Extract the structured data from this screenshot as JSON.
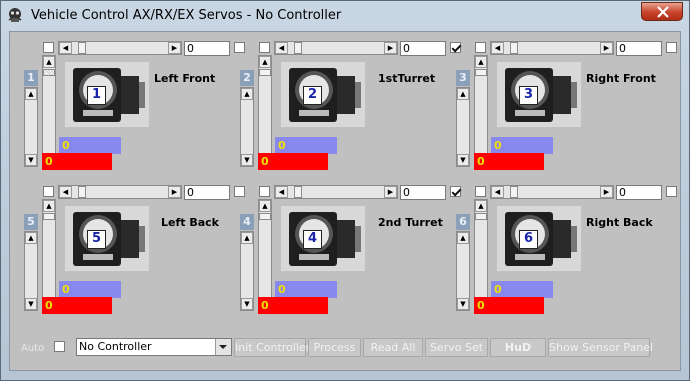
{
  "window": {
    "title": "Vehicle Control AX/RX/EX Servos - No Controller"
  },
  "panels": [
    {
      "id": "1",
      "label": "Left Front",
      "value": "0",
      "blue": "0",
      "red": "0",
      "checked": false
    },
    {
      "id": "2",
      "label": "1stTurret",
      "value": "0",
      "blue": "0",
      "red": "0",
      "checked": true
    },
    {
      "id": "3",
      "label": "Right Front",
      "value": "0",
      "blue": "0",
      "red": "0",
      "checked": false
    },
    {
      "id": "5",
      "label": "Left Back",
      "value": "0",
      "blue": "0",
      "red": "0",
      "checked": false
    },
    {
      "id": "4",
      "label": "2nd Turret",
      "value": "0",
      "blue": "0",
      "red": "0",
      "checked": true
    },
    {
      "id": "6",
      "label": "Right Back",
      "value": "0",
      "blue": "0",
      "red": "0",
      "checked": false
    }
  ],
  "bottom": {
    "auto_label": "Auto",
    "controller_select": "No Controller",
    "buttons": [
      "Init Controller",
      "Process",
      "Read All",
      "Servo Set",
      "HuD",
      "Show Sensor Panel"
    ]
  },
  "colors": {
    "blue_bar": "#8888ee",
    "red_bar": "#ff0000",
    "value_text": "#f0e000",
    "servo_number": "#1a24a8"
  },
  "icons": {
    "app": "robot-icon",
    "close": "close-icon",
    "left": "arrow-left-icon",
    "right": "arrow-right-icon",
    "up": "arrow-up-icon",
    "down": "arrow-down-icon"
  }
}
